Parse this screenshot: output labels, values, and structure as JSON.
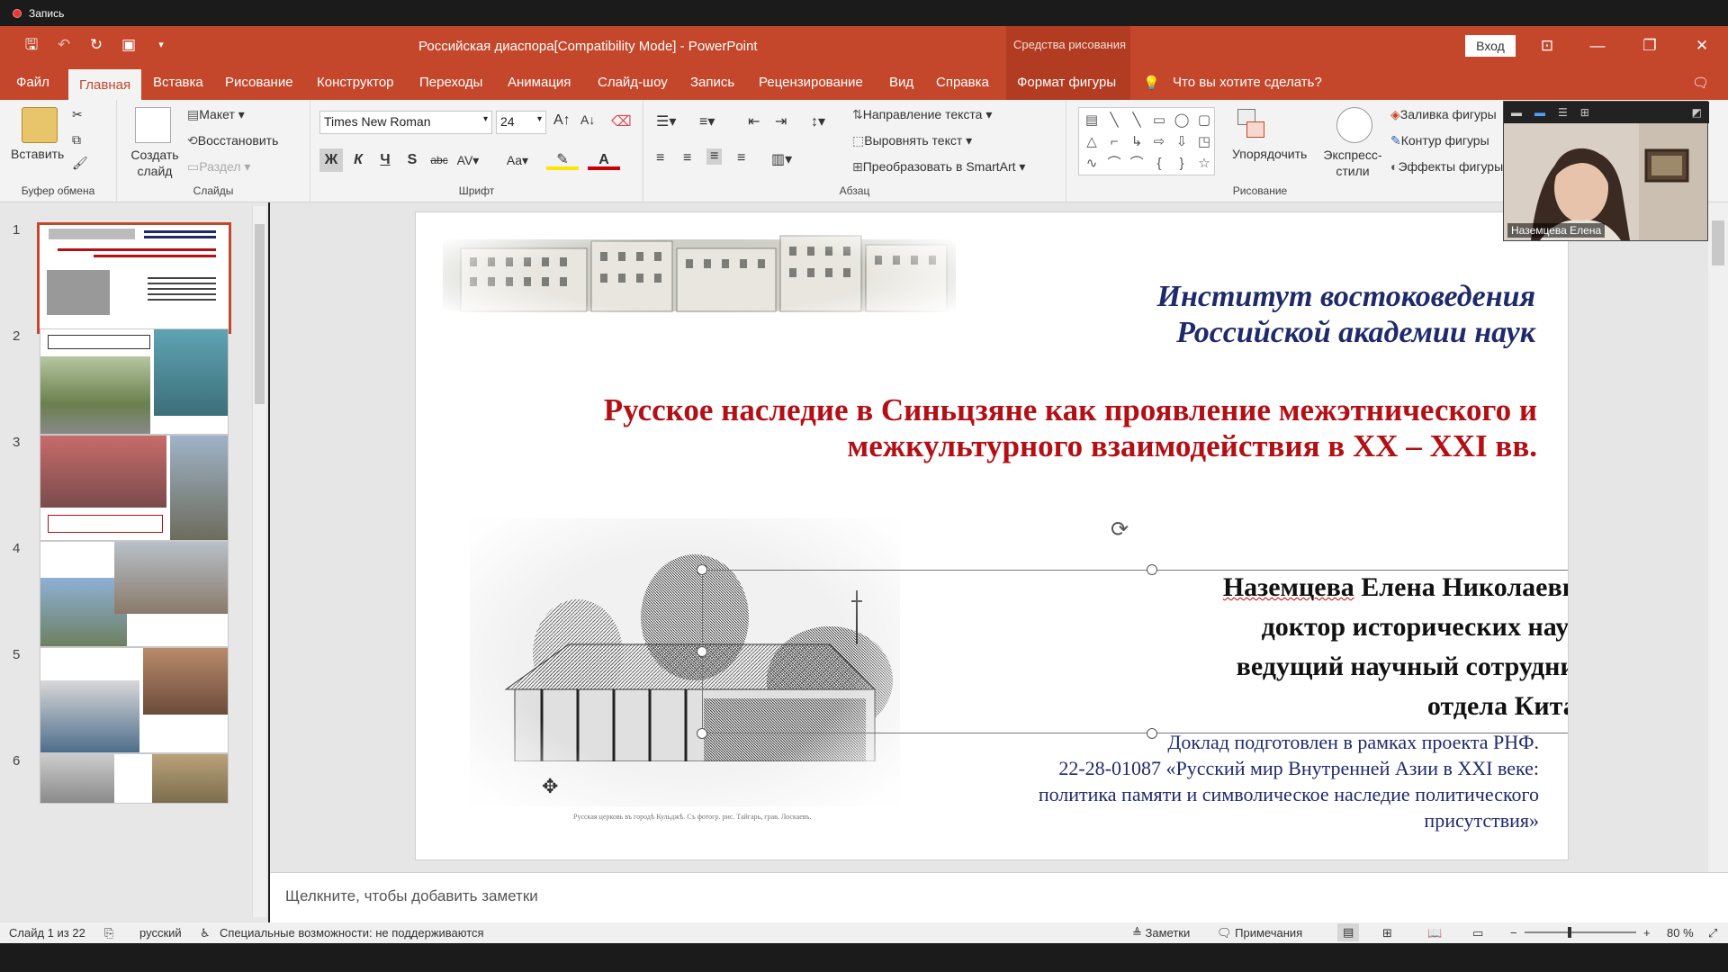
{
  "recording": {
    "label": "Запись"
  },
  "titlebar": {
    "document_title": "Российская диаспора[Compatibility Mode]  -  PowerPoint",
    "context_label": "Средства рисования",
    "signin": "Вход"
  },
  "tabs": [
    "Файл",
    "Главная",
    "Вставка",
    "Рисование",
    "Конструктор",
    "Переходы",
    "Анимация",
    "Слайд-шоу",
    "Запись",
    "Рецензирование",
    "Вид",
    "Справка",
    "Формат фигуры"
  ],
  "tell_me": "Что вы хотите сделать?",
  "ribbon": {
    "clipboard": {
      "paste": "Вставить",
      "label": "Буфер обмена"
    },
    "slides": {
      "new_slide": "Создать слайд",
      "layout": "Макет",
      "reset": "Восстановить",
      "section": "Раздел",
      "label": "Слайды"
    },
    "font": {
      "name": "Times New Roman",
      "size": "24",
      "label": "Шрифт",
      "bold": "Ж",
      "italic": "К",
      "underline": "Ч",
      "shadow": "S",
      "strike": "abc",
      "aa": "Aa"
    },
    "paragraph": {
      "text_direction": "Направление текста",
      "align_text": "Выровнять текст",
      "smartart": "Преобразовать в SmartArt",
      "label": "Абзац"
    },
    "drawing": {
      "arrange": "Упорядочить",
      "quick_styles": "Экспресс-стили",
      "fill": "Заливка фигуры",
      "outline": "Контур фигуры",
      "effects": "Эффекты фигуры",
      "label": "Рисование"
    }
  },
  "thumbnails": [
    "1",
    "2",
    "3",
    "4",
    "5",
    "6"
  ],
  "slide": {
    "institute_line1": "Институт востоковедения",
    "institute_line2": "Российской академии наук",
    "title_line1": "Русское наследие в Синьцзяне как проявление межэтнического и",
    "title_line2": "межкультурного взаимодействия в XX – XXI вв.",
    "author_name": "Наземцева",
    "author_rest": " Елена Николаевна",
    "author_line2": "доктор исторических наук,",
    "author_line3": "ведущий научный сотрудник",
    "author_line4": "отдела Китая",
    "report_line1": "Доклад подготовлен в рамках проекта РНФ.",
    "report_line2": "22-28-01087 «Русский мир Внутренней Азии в XXI веке:",
    "report_line3": "политика памяти и символическое наследие политического",
    "report_line4": "присутствия»",
    "engraving_caption": "Русская церковь въ городѣ Кульджѣ. Съ фотогр. рис. Тайгарь, грав. Лоскаевъ."
  },
  "notes_placeholder": "Щелкните, чтобы добавить заметки",
  "status": {
    "slide_counter": "Слайд 1 из 22",
    "language": "русский",
    "accessibility": "Специальные возможности: не поддерживаются",
    "notes": "Заметки",
    "comments": "Примечания",
    "zoom": "80 %"
  },
  "video": {
    "participant": "Наземцева Елена"
  },
  "colors": {
    "accent": "#c5472b",
    "title_red": "#b30f15",
    "navy": "#1f2a6b"
  }
}
